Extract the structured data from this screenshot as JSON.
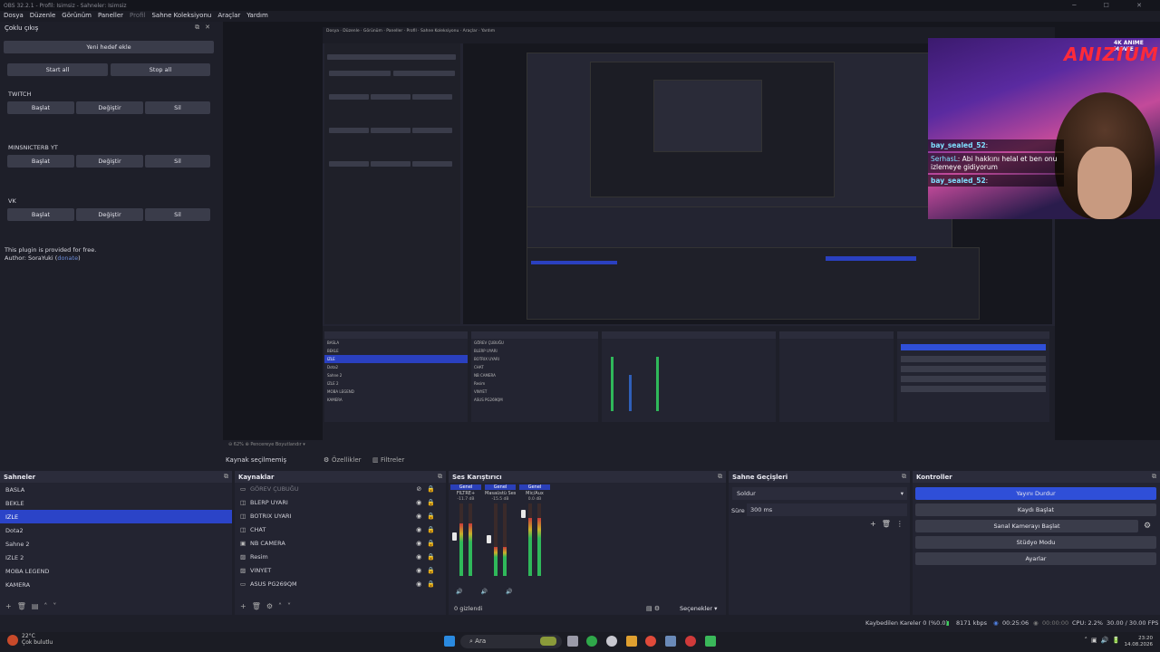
{
  "window": {
    "title": "OBS 32.2.1 - Profil: Isimsiz - Sahneler: Isimsiz",
    "controls": "─ ☐ ✕"
  },
  "menu": [
    "Dosya",
    "Düzenle",
    "Görünüm",
    "Paneller",
    "Profil",
    "Sahne Koleksiyonu",
    "Araçlar",
    "Yardım"
  ],
  "multi_output": {
    "title": "Çoklu çıkış",
    "add_target": "Yeni hedef ekle",
    "start_all": "Start all",
    "stop_all": "Stop all",
    "targets": [
      {
        "name": "TWITCH",
        "start": "Başlat",
        "edit": "Değiştir",
        "delete": "Sil"
      },
      {
        "name": "MINSNICTERB YT",
        "start": "Başlat",
        "edit": "Değiştir",
        "delete": "Sil"
      },
      {
        "name": "VK",
        "start": "Başlat",
        "edit": "Değiştir",
        "delete": "Sil"
      }
    ],
    "footer_line1": "This plugin is provided for free.",
    "footer_line2_prefix": "Author: SoraYuki (",
    "footer_link": "donate",
    "footer_line2_suffix": ")"
  },
  "preview": {
    "chat": [
      {
        "user": "bay_sealed_52",
        "text": ": "
      },
      {
        "user": "SerhasL",
        "text": ": Abi hakkını helal et ben onu izlemeye gidiyorum"
      },
      {
        "user": "bay_sealed_52",
        "text": ": "
      }
    ],
    "overlay_brand_top": "4K ANIME MOVIE",
    "overlay_brand": "ANIZIUM",
    "zoom": "62%",
    "zoom_mode": "Pencereye Boyutlandır"
  },
  "source_bar": {
    "label": "Kaynak seçilmemiş",
    "properties": "Özellikler",
    "filters": "Filtreler"
  },
  "scenes": {
    "title": "Sahneler",
    "items": [
      "BASLA",
      "BEKLE",
      "IZLE",
      "Dota2",
      "Sahne 2",
      "IZLE 2",
      "MOBA LEGEND",
      "KAMERA"
    ],
    "selected": "IZLE"
  },
  "sources": {
    "title": "Kaynaklar",
    "items": [
      {
        "name": "GÖREV ÇUBUĞU",
        "icon": "window-icon",
        "hidden": true
      },
      {
        "name": "BLERP UYARI",
        "icon": "browser-icon",
        "hidden": false
      },
      {
        "name": "BOTRIX UYARI",
        "icon": "browser-icon",
        "hidden": false
      },
      {
        "name": "CHAT",
        "icon": "browser-icon",
        "hidden": false
      },
      {
        "name": "NB CAMERA",
        "icon": "camera-icon",
        "hidden": false
      },
      {
        "name": "Resim",
        "icon": "image-icon",
        "hidden": false
      },
      {
        "name": "VINYET",
        "icon": "image-icon",
        "hidden": false
      },
      {
        "name": "ASUS PG269QM",
        "icon": "monitor-icon",
        "hidden": false
      }
    ]
  },
  "mixer": {
    "title": "Ses Karıştırıcı",
    "channels": [
      {
        "header": "Genel",
        "name": "FILTRE+",
        "db": "-11.7 dB",
        "level": 0.72,
        "fader": 0.55
      },
      {
        "header": "Genel",
        "name": "Masaüstü Ses",
        "db": "-15.5 dB",
        "level": 0.4,
        "fader": 0.5
      },
      {
        "header": "Genel",
        "name": "Mic/Aux",
        "db": "0.0 dB",
        "level": 0.8,
        "fader": 0.9
      }
    ],
    "hidden_count": "0 gizlendi",
    "options": "Seçenekler"
  },
  "transitions": {
    "title": "Sahne Geçişleri",
    "type": "Soldur",
    "duration_label": "Süre",
    "duration": "300 ms"
  },
  "controls": {
    "title": "Kontroller",
    "stop_stream": "Yayını Durdur",
    "start_recording": "Kaydı Başlat",
    "virtual_cam": "Sanal Kamerayı Başlat",
    "studio_mode": "Stüdyo Modu",
    "settings": "Ayarlar"
  },
  "status": {
    "dropped": "Kaybedilen Kareler 0 (%0.0)",
    "bitrate": "8171 kbps",
    "stream_time": "00:25:06",
    "rec_time": "00:00:00",
    "cpu": "CPU: 2.2%",
    "fps": "30.00 / 30.00 FPS"
  },
  "taskbar": {
    "weather_temp": "22°C",
    "weather_text": "Çok bulutlu",
    "search": "Ara",
    "time": "23:20",
    "date": "14.08.2026"
  },
  "colors": {
    "accent": "#2b44c8",
    "active_button": "#2f4fd8",
    "brand_red": "#ff2a3a"
  }
}
